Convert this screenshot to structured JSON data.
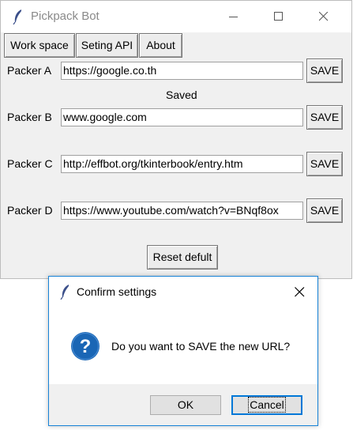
{
  "main_window": {
    "title": "Pickpack Bot",
    "menu": {
      "workspace": "Work space",
      "set_api": "Seting API",
      "about": "About"
    },
    "rows": [
      {
        "label": "Packer A",
        "url": "https://google.co.th",
        "save": "SAVE"
      },
      {
        "label": "Packer B",
        "url": "www.google.com",
        "save": "SAVE"
      },
      {
        "label": "Packer C",
        "url": "http://effbot.org/tkinterbook/entry.htm",
        "save": "SAVE"
      },
      {
        "label": "Packer D",
        "url": "https://www.youtube.com/watch?v=BNqf8ox",
        "save": "SAVE"
      }
    ],
    "status": "Saved",
    "reset_label": "Reset defult"
  },
  "dialog": {
    "title": "Confirm settings",
    "message": "Do you want to SAVE the new URL?",
    "ok_label": "OK",
    "cancel_label": "Cancel"
  },
  "colors": {
    "accent": "#0078d7",
    "question_icon": "#1a66b5"
  }
}
